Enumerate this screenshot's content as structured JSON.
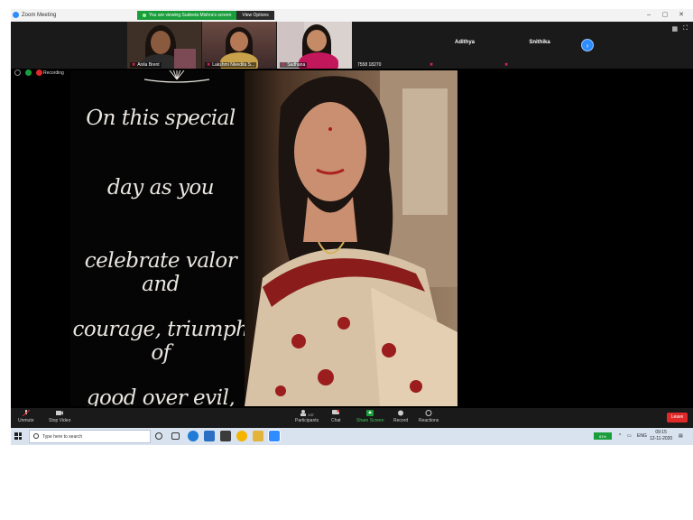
{
  "window": {
    "title": "Zoom Meeting"
  },
  "share_banner": {
    "message": "You are viewing Sudeeta Mishra's screen",
    "options_label": "View Options"
  },
  "gallery": {
    "participants": [
      {
        "name": "Anila Brent"
      },
      {
        "name": "Lakshmi Nivedita S..."
      },
      {
        "name": "Sadhana"
      },
      {
        "name": "7558 18270"
      },
      {
        "name": "Adithya"
      },
      {
        "name": "Snithika"
      }
    ]
  },
  "recording": {
    "label": "Recording"
  },
  "shared_card": {
    "lines": [
      "On this special",
      "day as you",
      "celebrate valor and",
      "courage, triumph of",
      "good over evil,"
    ]
  },
  "controls": {
    "unmute": "Unmute",
    "stop_video": "Stop Video",
    "participants": "Participants",
    "participants_count": "137",
    "chat": "Chat",
    "share_screen": "Share Screen",
    "record": "Record",
    "reactions": "Reactions",
    "leave": "Leave"
  },
  "taskbar": {
    "search_placeholder": "Type here to search",
    "battery": "81%",
    "language": "ENG",
    "time": "09:15",
    "date": "12-11-2020"
  }
}
